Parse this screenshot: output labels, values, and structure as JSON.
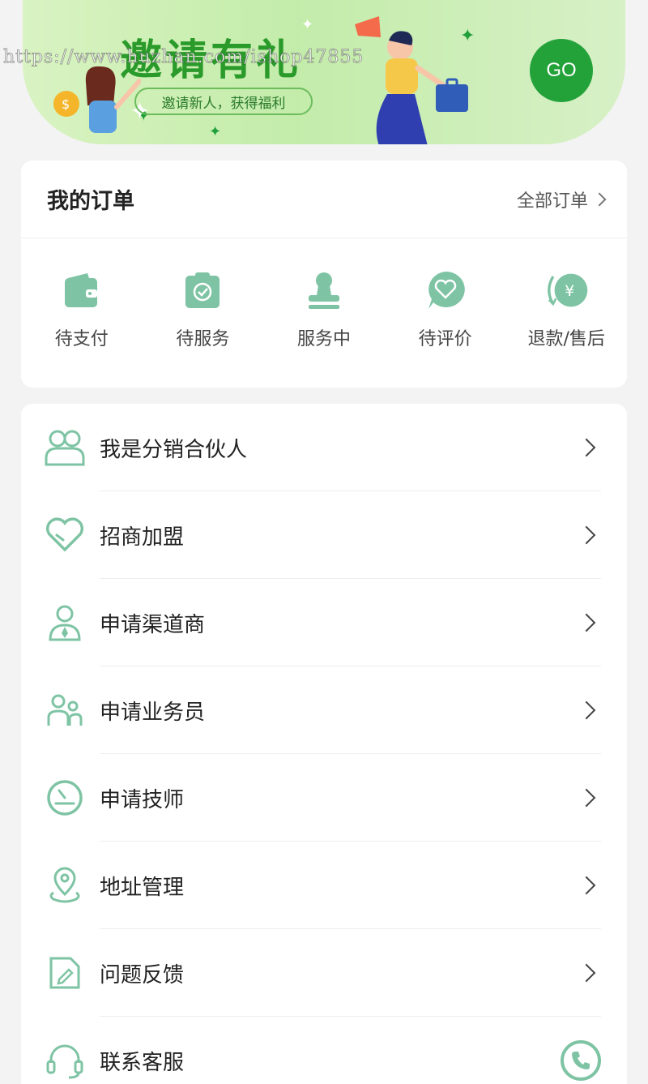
{
  "banner": {
    "title": "邀请有礼",
    "subtitle": "邀请新人，获得福利",
    "go_label": "GO",
    "watermark": "https://www.huzhan.com/ishop47855"
  },
  "orders": {
    "title": "我的订单",
    "all_label": "全部订单",
    "items": [
      {
        "label": "待支付",
        "icon": "wallet-icon"
      },
      {
        "label": "待服务",
        "icon": "clipboard-check-icon"
      },
      {
        "label": "服务中",
        "icon": "stamp-icon"
      },
      {
        "label": "待评价",
        "icon": "heart-bubble-icon"
      },
      {
        "label": "退款/售后",
        "icon": "refund-yen-icon"
      }
    ]
  },
  "menu": {
    "items": [
      {
        "label": "我是分销合伙人",
        "icon": "partners-icon"
      },
      {
        "label": "招商加盟",
        "icon": "heart-icon"
      },
      {
        "label": "申请渠道商",
        "icon": "person-tie-icon"
      },
      {
        "label": "申请业务员",
        "icon": "staff-icon"
      },
      {
        "label": "申请技师",
        "icon": "gauge-icon"
      },
      {
        "label": "地址管理",
        "icon": "location-pin-icon"
      },
      {
        "label": "问题反馈",
        "icon": "edit-note-icon"
      },
      {
        "label": "联系客服",
        "icon": "headset-icon"
      }
    ]
  },
  "colors": {
    "accent": "#7ec4a4",
    "go_button": "#23a23a",
    "banner_bg": "#c3ecaa"
  }
}
